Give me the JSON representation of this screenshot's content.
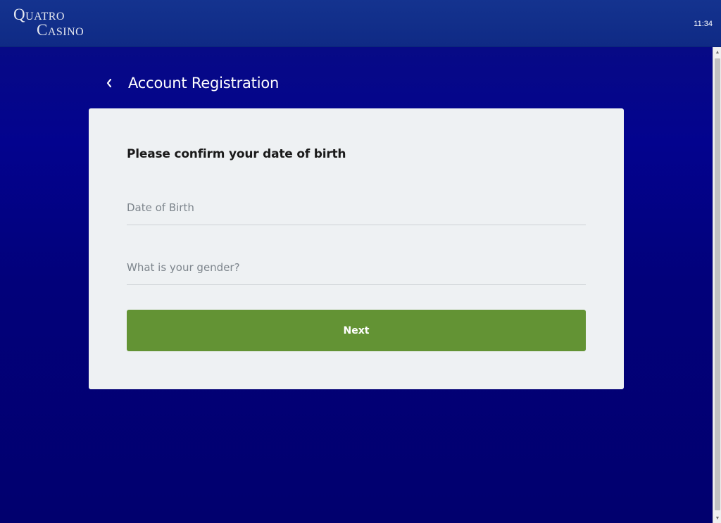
{
  "header": {
    "logo_line1": "Quatro",
    "logo_line2": "Casino",
    "clock": "11:34"
  },
  "page": {
    "title": "Account Registration",
    "back_icon": "chevron-left-icon"
  },
  "form": {
    "heading": "Please confirm your date of birth",
    "fields": [
      {
        "label": "Date of Birth",
        "value": ""
      },
      {
        "label": "What is your gender?",
        "value": ""
      }
    ],
    "next_label": "Next"
  },
  "colors": {
    "header_bg": "#12308b",
    "main_bg": "#01006e",
    "card_bg": "#eef1f3",
    "button_bg": "#639334",
    "label_text": "#7d858c"
  }
}
